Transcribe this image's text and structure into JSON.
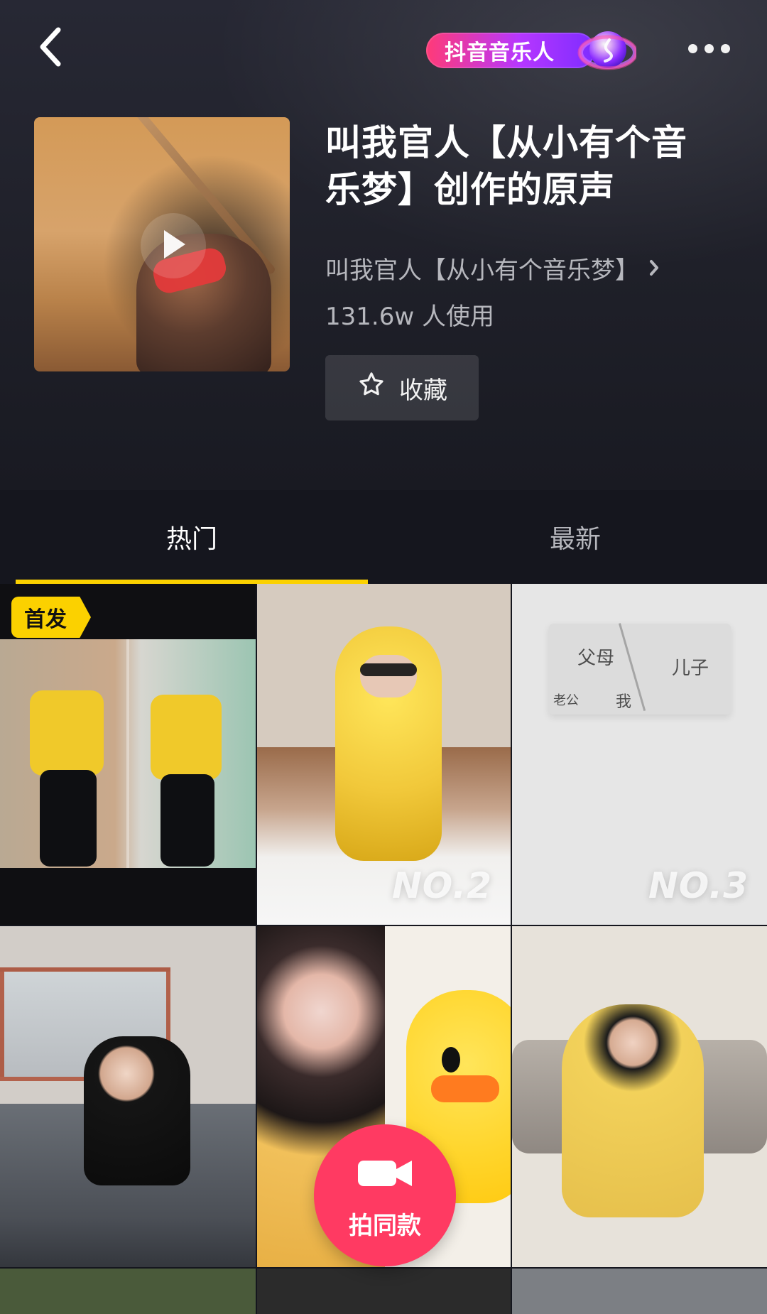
{
  "header": {
    "brand_text": "抖音音乐人",
    "title": "叫我官人【从小有个音乐梦】创作的原声",
    "artist": "叫我官人【从小有个音乐梦】",
    "usage": "131.6w 人使用",
    "favorite_label": "收藏"
  },
  "tabs": [
    {
      "label": "热门",
      "selected": true
    },
    {
      "label": "最新",
      "selected": false
    }
  ],
  "grid": {
    "first_badge": "首发",
    "ranks": [
      "NO.2",
      "NO.3"
    ],
    "paper_text": {
      "parents": "父母",
      "son": "儿子",
      "husband": "老公",
      "me": "我"
    }
  },
  "shoot_button": {
    "label": "拍同款"
  },
  "icons": {
    "back": "chevron-left",
    "more": "ellipsis",
    "play": "play",
    "favorite": "star-outline",
    "artist_chevron": "chevron-right",
    "shoot": "video-camera"
  },
  "colors": {
    "accent_yellow": "#fbd100",
    "shoot_red": "#ff3a62",
    "brand_purple": "#b737ff",
    "brand_pink": "#ff3a77"
  }
}
